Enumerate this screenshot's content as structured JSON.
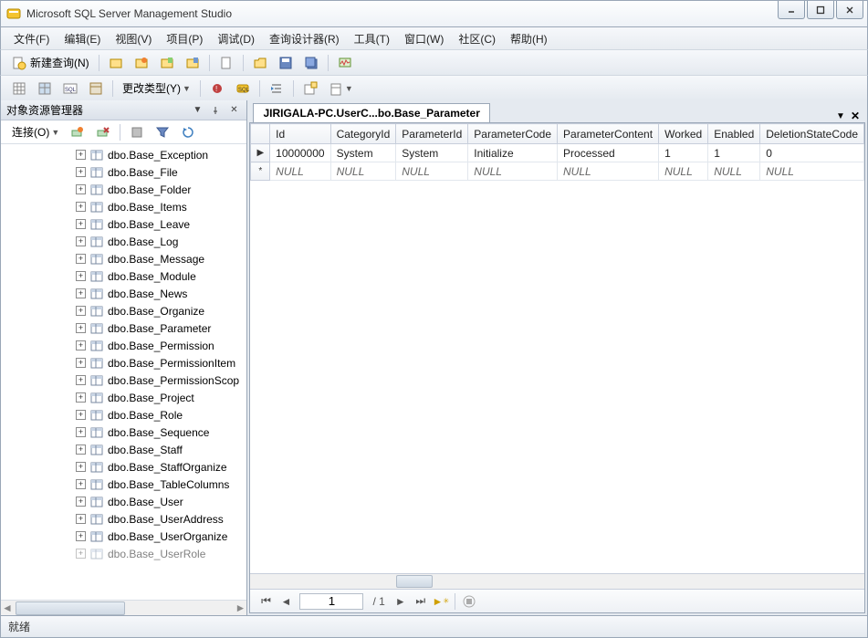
{
  "app": {
    "title": "Microsoft SQL Server Management Studio"
  },
  "menu": {
    "file": "文件(F)",
    "edit": "编辑(E)",
    "view": "视图(V)",
    "project": "项目(P)",
    "debug": "调试(D)",
    "query_designer": "查询设计器(R)",
    "tools": "工具(T)",
    "window": "窗口(W)",
    "community": "社区(C)",
    "help": "帮助(H)"
  },
  "toolbar1": {
    "new_query": "新建查询(N)"
  },
  "toolbar2": {
    "change_type": "更改类型(Y)"
  },
  "explorer": {
    "title": "对象资源管理器",
    "connect": "连接(O)",
    "nodes": [
      "dbo.Base_Exception",
      "dbo.Base_File",
      "dbo.Base_Folder",
      "dbo.Base_Items",
      "dbo.Base_Leave",
      "dbo.Base_Log",
      "dbo.Base_Message",
      "dbo.Base_Module",
      "dbo.Base_News",
      "dbo.Base_Organize",
      "dbo.Base_Parameter",
      "dbo.Base_Permission",
      "dbo.Base_PermissionItem",
      "dbo.Base_PermissionScop",
      "dbo.Base_Project",
      "dbo.Base_Role",
      "dbo.Base_Sequence",
      "dbo.Base_Staff",
      "dbo.Base_StaffOrganize",
      "dbo.Base_TableColumns",
      "dbo.Base_User",
      "dbo.Base_UserAddress",
      "dbo.Base_UserOrganize",
      "dbo.Base_UserRole"
    ]
  },
  "document": {
    "tab_title": "JIRIGALA-PC.UserC...bo.Base_Parameter",
    "columns": [
      "Id",
      "CategoryId",
      "ParameterId",
      "ParameterCode",
      "ParameterContent",
      "Worked",
      "Enabled",
      "DeletionStateCode"
    ],
    "rows": [
      {
        "marker": "▶",
        "cells": [
          "10000000",
          "System",
          "System",
          "Initialize",
          "Processed",
          "1",
          "1",
          "0"
        ]
      },
      {
        "marker": "*",
        "cells": [
          "NULL",
          "NULL",
          "NULL",
          "NULL",
          "NULL",
          "NULL",
          "NULL",
          "NULL"
        ]
      }
    ],
    "nav": {
      "current": "1",
      "total": "/ 1"
    }
  },
  "status": {
    "text": "就绪"
  }
}
